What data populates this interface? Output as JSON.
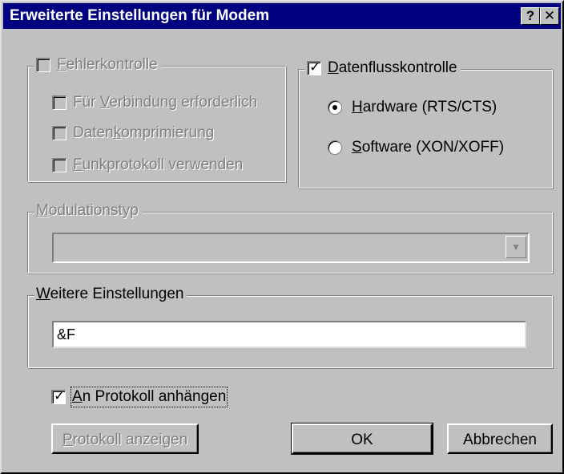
{
  "window": {
    "title": "Erweiterte Einstellungen für Modem",
    "help_btn": "?",
    "close_btn": "✕"
  },
  "fehlerkontrolle": {
    "pre": "",
    "acc": "F",
    "post": "ehlerkontrolle",
    "checked": false,
    "enabled": false,
    "options": [
      {
        "pre": "Für ",
        "acc": "V",
        "post": "erbindung erforderlich"
      },
      {
        "pre": "Daten",
        "acc": "k",
        "post": "omprimierung"
      },
      {
        "pre": "",
        "acc": "F",
        "post": "unkprotokoll verwenden"
      }
    ]
  },
  "datenfluss": {
    "pre": "",
    "acc": "D",
    "post": "atenflusskontrolle",
    "checked": true,
    "options": [
      {
        "pre": "",
        "acc": "H",
        "post": "ardware (RTS/CTS)",
        "selected": true
      },
      {
        "pre": "",
        "acc": "S",
        "post": "oftware (XON/XOFF)",
        "selected": false
      }
    ]
  },
  "modulation": {
    "pre": "",
    "acc": "M",
    "post": "odulationstyp",
    "value": ""
  },
  "weitere": {
    "pre": "",
    "acc": "W",
    "post": "eitere Einstellungen",
    "value": "&F"
  },
  "protokoll_anhaengen": {
    "pre": "",
    "acc": "A",
    "post": "n Protokoll anhängen",
    "checked": true
  },
  "buttons": {
    "protokoll": {
      "pre": "",
      "acc": "P",
      "post": "rotokoll anzeigen"
    },
    "ok": "OK",
    "cancel": "Abbrechen"
  }
}
